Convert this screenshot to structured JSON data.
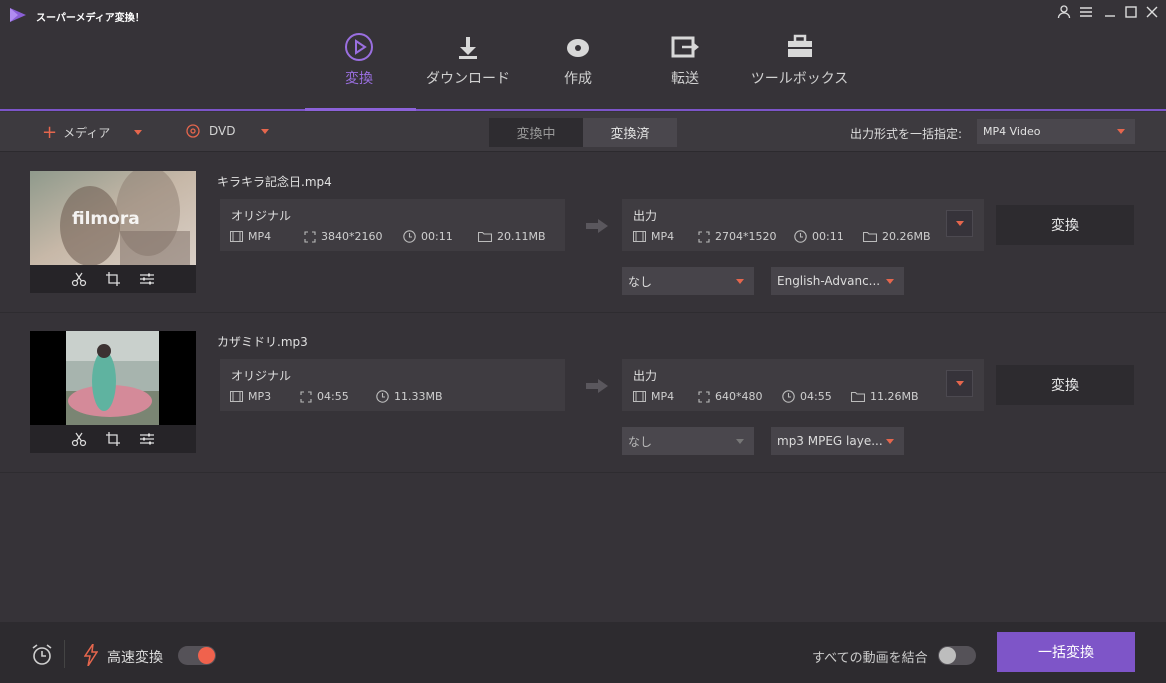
{
  "app": {
    "title": "スーパーメディア変換！"
  },
  "nav": {
    "tabs": [
      {
        "label": "変換",
        "icon": "convert-icon"
      },
      {
        "label": "ダウンロード",
        "icon": "download-icon"
      },
      {
        "label": "作成",
        "icon": "disc-icon"
      },
      {
        "label": "転送",
        "icon": "transfer-icon"
      },
      {
        "label": "ツールボックス",
        "icon": "toolbox-icon"
      }
    ],
    "active_tab": "変換"
  },
  "toolbar": {
    "add_media_label": "メディア",
    "dvd_label": "DVD",
    "seg_in_progress": "変換中",
    "seg_done": "変換済",
    "output_format_label": "出力形式を一括指定:",
    "output_format_value": "MP4 Video"
  },
  "files": [
    {
      "name": "キラキラ記念日.mp4",
      "thumbnail_text": "filmora",
      "source": {
        "title": "オリジナル",
        "format": "MP4",
        "resolution": "3840*2160",
        "duration": "00:11",
        "size": "20.11MB"
      },
      "output": {
        "title": "出力",
        "format": "MP4",
        "resolution": "2704*1520",
        "duration": "00:11",
        "size": "20.26MB"
      },
      "subtitle": "なし",
      "audio": "English-Advanc...",
      "convert_label": "変換"
    },
    {
      "name": "カザミドリ.mp3",
      "source": {
        "title": "オリジナル",
        "format": "MP3",
        "duration": "04:55",
        "size": "11.33MB"
      },
      "output": {
        "title": "出力",
        "format": "MP4",
        "resolution": "640*480",
        "duration": "04:55",
        "size": "11.26MB"
      },
      "subtitle": "なし",
      "audio": "mp3 MPEG laye...",
      "convert_label": "変換"
    }
  ],
  "bottom": {
    "fast_convert_label": "高速変換",
    "fast_convert_on": true,
    "merge_label": "すべての動画を結合",
    "merge_on": false,
    "batch_convert_label": "一括変換"
  },
  "colors": {
    "accent": "#7e55c8",
    "orange": "#e5664d",
    "bg": "#363338"
  }
}
